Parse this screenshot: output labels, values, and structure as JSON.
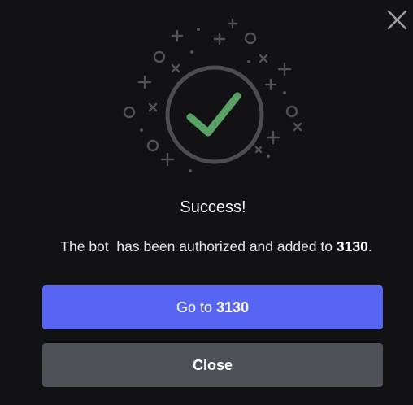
{
  "dialog": {
    "close_icon": "close-icon",
    "illustration_icon": "success-checkmark-icon",
    "title": "Success!",
    "message": {
      "prefix": "The bot  has been authorized and added to ",
      "server_name": "3130",
      "suffix": "."
    },
    "primary_button": {
      "prefix": "Go to ",
      "server_name": "3130"
    },
    "secondary_button": {
      "label": "Close"
    }
  },
  "colors": {
    "background": "#121215",
    "check": "#5aa166",
    "ring": "#4f5054",
    "primary_button": "#5865f2",
    "secondary_button": "#4e5058"
  }
}
